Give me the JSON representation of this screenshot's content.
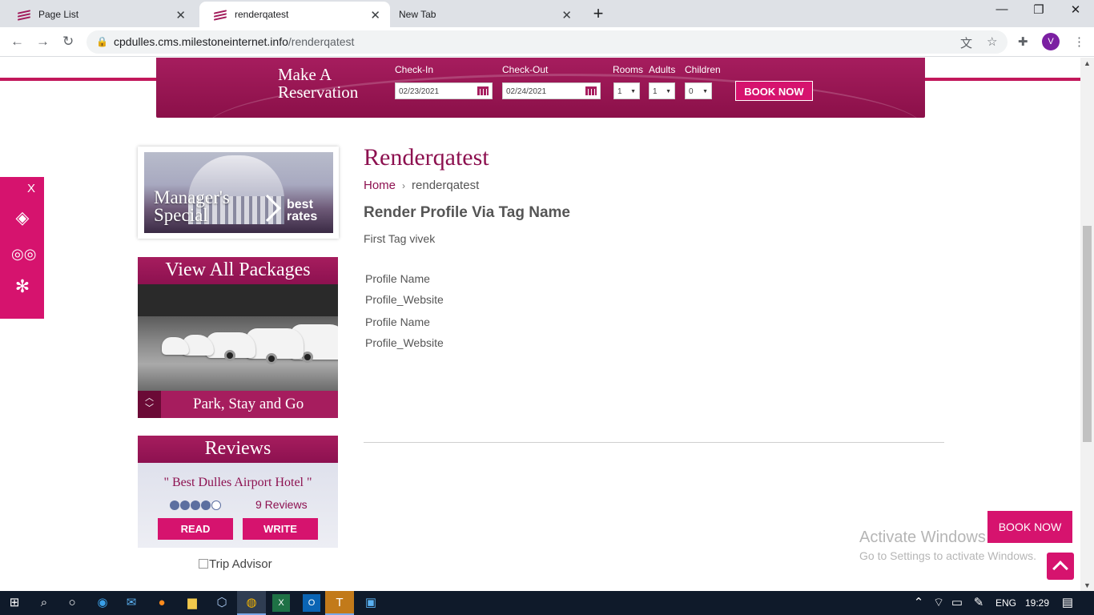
{
  "browser": {
    "tabs": [
      {
        "title": "Page List"
      },
      {
        "title": "renderqatest"
      },
      {
        "title": "New Tab"
      }
    ],
    "url_host": "cpdulles.cms.milestoneinternet.info",
    "url_path": "/renderqatest",
    "profile_initial": "V"
  },
  "reservation": {
    "title_line1": "Make A",
    "title_line2": "Reservation",
    "checkin_label": "Check-In",
    "checkin_value": "02/23/2021",
    "checkout_label": "Check-Out",
    "checkout_value": "02/24/2021",
    "rooms_label": "Rooms",
    "rooms_value": "1",
    "adults_label": "Adults",
    "adults_value": "1",
    "children_label": "Children",
    "children_value": "0",
    "book_label": "BOOK NOW"
  },
  "social": {
    "close_label": "X"
  },
  "special": {
    "line1": "Manager's",
    "line2": "Special",
    "best1": "best",
    "best2": "rates"
  },
  "packages": {
    "heading": "View All Packages",
    "caption": "Park, Stay and Go"
  },
  "reviews": {
    "heading": "Reviews",
    "quote": "\" Best Dulles Airport Hotel \"",
    "rating": 4,
    "count_label": "9 Reviews",
    "read_label": "READ",
    "write_label": "WRITE",
    "trip_alt": "Trip Advisor"
  },
  "main": {
    "title": "Renderqatest",
    "breadcrumb_home": "Home",
    "breadcrumb_current": "renderqatest",
    "section_heading": "Render Profile Via Tag Name",
    "tag_text": "First Tag vivek",
    "profiles": [
      "Profile Name",
      "Profile_Website",
      "Profile Name",
      "Profile_Website"
    ]
  },
  "floating": {
    "book_label": "BOOK NOW",
    "watermark_line1": "Activate Windows",
    "watermark_line2": "Go to Settings to activate Windows."
  },
  "taskbar": {
    "lang": "ENG",
    "time": "19:29"
  },
  "colors": {
    "brand": "#a61d5e",
    "accent": "#d6136e"
  }
}
